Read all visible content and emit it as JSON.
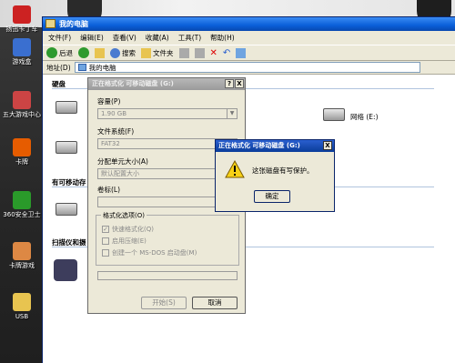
{
  "desktop": {
    "icons": [
      {
        "label": "扬迅卡丁车",
        "icon": "kart-icon",
        "color": "#c22"
      },
      {
        "label": "游戏盒",
        "icon": "gamebox-icon",
        "color": "#3a6fd0"
      },
      {
        "label": "五大游戏中心",
        "icon": "game-center-icon",
        "color": "#c44"
      },
      {
        "label": "卡牌",
        "icon": "card-icon",
        "color": "#e65c00"
      },
      {
        "label": "360安全卫士",
        "icon": "shield-icon",
        "color": "#2a9a2a"
      },
      {
        "label": "卡牌游戏",
        "icon": "card-game-icon",
        "color": "#d84"
      },
      {
        "label": "USB",
        "icon": "usb-folder-icon",
        "color": "#e8c450"
      }
    ]
  },
  "explorer": {
    "title": "我的电脑",
    "menu": [
      "文件(F)",
      "编辑(E)",
      "查看(V)",
      "收藏(A)",
      "工具(T)",
      "帮助(H)"
    ],
    "toolbar": {
      "back": "后退",
      "search": "搜索",
      "folders": "文件夹"
    },
    "address": {
      "label": "地址(D)",
      "value": "我的电脑"
    },
    "groups": {
      "hard_drives": "硬盘",
      "removable": "有可移动存",
      "scanners": "扫描仪和摄"
    },
    "drives": [
      {
        "label": "网络 (E:)"
      }
    ]
  },
  "format_dialog": {
    "title": "正在格式化 可移动磁盘 (G:)",
    "help_button": "?",
    "close_button": "X",
    "capacity_label": "容量(P)",
    "capacity_value": "1.90 GB",
    "filesystem_label": "文件系统(F)",
    "filesystem_value": "FAT32",
    "alloc_label": "分配单元大小(A)",
    "alloc_value": "默认配置大小",
    "volume_label": "卷标(L)",
    "volume_value": "",
    "options_title": "格式化选项(O)",
    "options": [
      {
        "label": "快速格式化(Q)",
        "checked": true
      },
      {
        "label": "启用压缩(E)",
        "checked": false
      },
      {
        "label": "创建一个 MS-DOS 启动盘(M)",
        "checked": false
      }
    ],
    "start_button": "开始(S)",
    "cancel_button": "取消"
  },
  "message_box": {
    "title": "正在格式化 可移动磁盘 (G:)",
    "close_button": "X",
    "icon": "warning-icon",
    "text": "这张磁盘有写保护。",
    "ok_button": "确定"
  }
}
